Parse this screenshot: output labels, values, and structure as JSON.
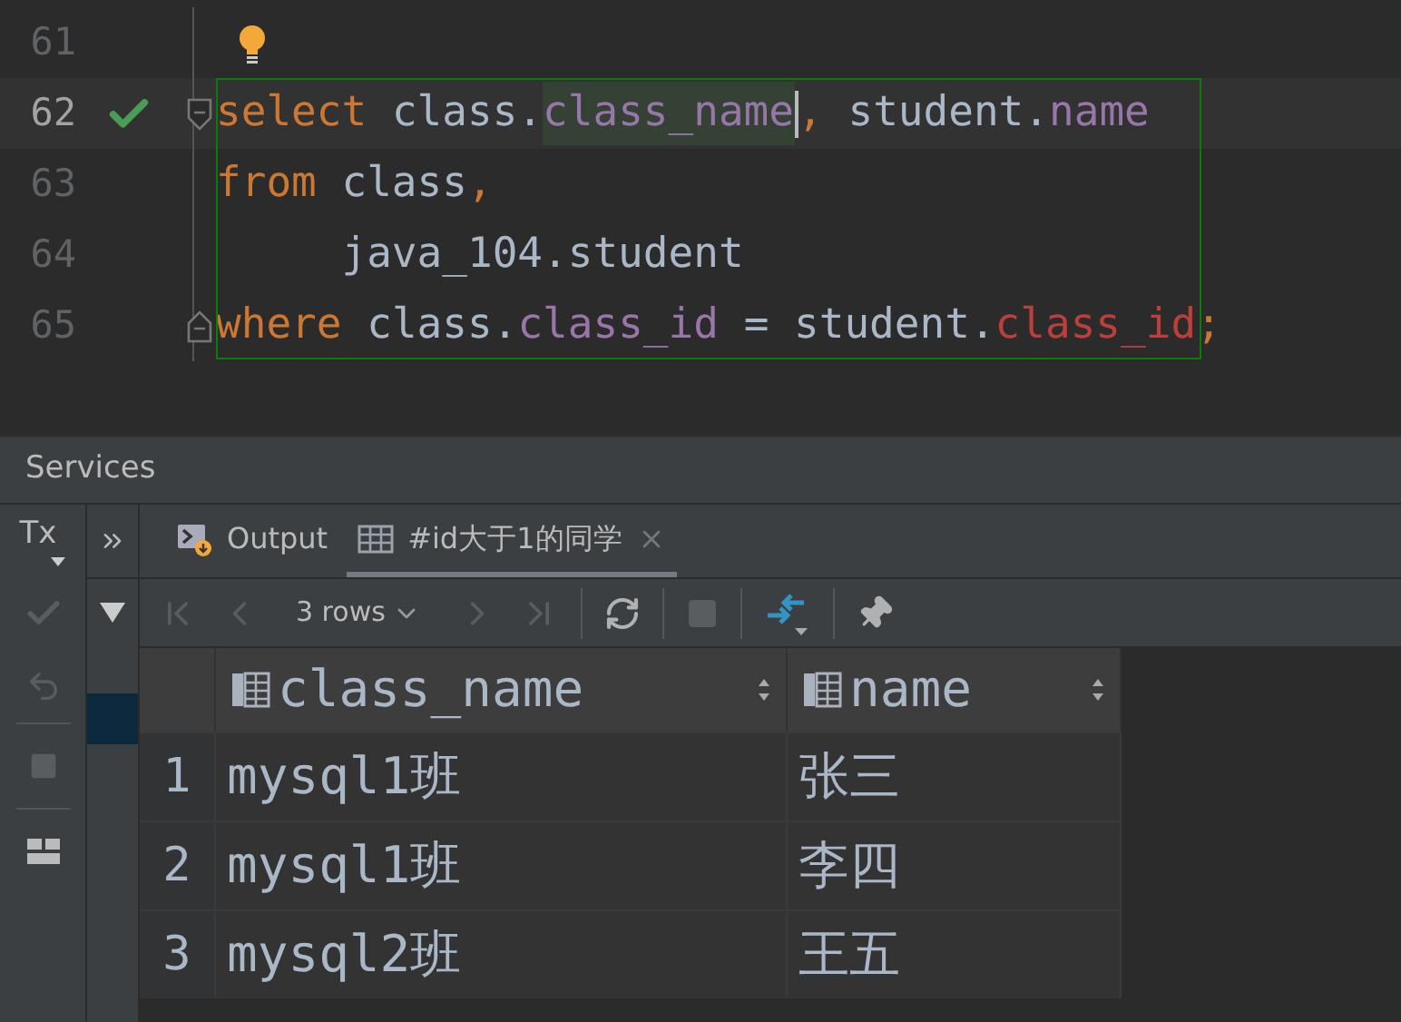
{
  "editor": {
    "lines": [
      {
        "number": "61",
        "current": false,
        "ok": false,
        "hint": true,
        "fold_start": false,
        "fold_end": false
      },
      {
        "number": "62",
        "current": true,
        "ok": true,
        "hint": false,
        "fold_start": true,
        "fold_end": false,
        "tokens": [
          {
            "text": "select",
            "kind": "keyword"
          },
          {
            "text": " class.",
            "kind": "plain"
          },
          {
            "text": "class_name",
            "kind": "column",
            "highlighted": true,
            "caret": true
          },
          {
            "text": ",",
            "kind": "keyword"
          },
          {
            "text": " student.",
            "kind": "plain"
          },
          {
            "text": "name",
            "kind": "column"
          }
        ]
      },
      {
        "number": "63",
        "current": false,
        "ok": false,
        "hint": false,
        "fold_start": false,
        "fold_end": false,
        "tokens": [
          {
            "text": "from",
            "kind": "keyword"
          },
          {
            "text": " class",
            "kind": "plain"
          },
          {
            "text": ",",
            "kind": "keyword"
          }
        ]
      },
      {
        "number": "64",
        "current": false,
        "ok": false,
        "hint": false,
        "fold_start": false,
        "fold_end": false,
        "tokens": [
          {
            "text": "     java_104.student",
            "kind": "plain"
          }
        ]
      },
      {
        "number": "65",
        "current": false,
        "ok": false,
        "hint": false,
        "fold_start": false,
        "fold_end": true,
        "tokens": [
          {
            "text": "where",
            "kind": "keyword"
          },
          {
            "text": " class.",
            "kind": "plain"
          },
          {
            "text": "class_id",
            "kind": "column"
          },
          {
            "text": " = student.",
            "kind": "plain"
          },
          {
            "text": "class_id",
            "kind": "unresolved"
          },
          {
            "text": ";",
            "kind": "keyword"
          }
        ]
      }
    ]
  },
  "services": {
    "title": "Services",
    "tx_label": "Tx",
    "tabs": [
      {
        "label": "Output",
        "kind": "output",
        "selected": false,
        "closable": false
      },
      {
        "label": "#id大于1的同学",
        "kind": "result",
        "selected": true,
        "closable": true
      }
    ],
    "toolbar": [
      {
        "kind": "first",
        "disabled": true
      },
      {
        "kind": "prev",
        "disabled": true
      },
      {
        "kind": "rows",
        "label": "3 rows"
      },
      {
        "kind": "next",
        "disabled": true
      },
      {
        "kind": "last",
        "disabled": true
      },
      {
        "kind": "sep"
      },
      {
        "kind": "reload",
        "disabled": false
      },
      {
        "kind": "sep"
      },
      {
        "kind": "stop",
        "disabled": true
      },
      {
        "kind": "sep"
      },
      {
        "kind": "compare",
        "disabled": false
      },
      {
        "kind": "sep"
      },
      {
        "kind": "pin",
        "disabled": false
      }
    ],
    "table": {
      "columns": [
        "class_name",
        "name"
      ],
      "rows": [
        {
          "number": "1",
          "cells": [
            "mysql1班",
            "张三"
          ]
        },
        {
          "number": "2",
          "cells": [
            "mysql1班",
            "李四"
          ]
        },
        {
          "number": "3",
          "cells": [
            "mysql2班",
            "王五"
          ]
        }
      ]
    }
  }
}
